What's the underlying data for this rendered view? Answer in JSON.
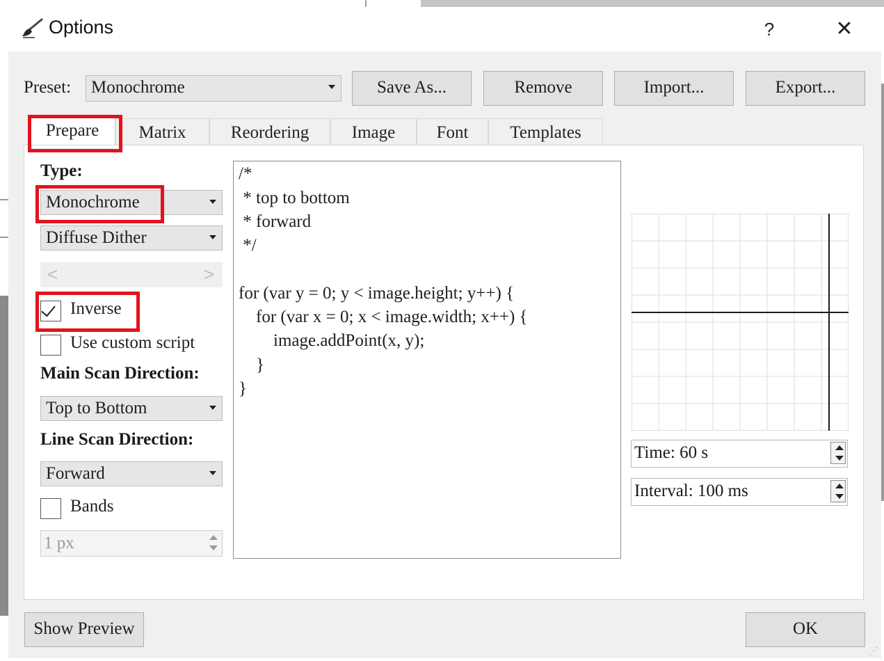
{
  "window": {
    "title": "Options",
    "help_label": "?",
    "close_label": "✕",
    "icon": "paintbrush-icon"
  },
  "preset": {
    "label": "Preset:",
    "value": "Monochrome",
    "buttons": [
      "Save As...",
      "Remove",
      "Import...",
      "Export..."
    ]
  },
  "tabs": [
    "Prepare",
    "Matrix",
    "Reordering",
    "Image",
    "Font",
    "Templates"
  ],
  "active_tab": "Prepare",
  "prepare": {
    "type_label": "Type:",
    "type_value": "Monochrome",
    "dither_value": "Diffuse Dither",
    "slider_left": "<",
    "slider_right": ">",
    "inverse_label": "Inverse",
    "inverse_checked": true,
    "custom_script_label": "Use custom script",
    "custom_script_checked": false,
    "main_scan_label": "Main Scan Direction:",
    "main_scan_value": "Top to Bottom",
    "line_scan_label": "Line Scan Direction:",
    "line_scan_value": "Forward",
    "bands_label": "Bands",
    "bands_checked": false,
    "bands_value": "1 px"
  },
  "script": {
    "lines": [
      "/*",
      " * top to bottom",
      " * forward",
      " */",
      "",
      "for (var y = 0; y < image.height; y++) {",
      "    for (var x = 0; x < image.width; x++) {",
      "        image.addPoint(x, y);",
      "    }",
      "}"
    ]
  },
  "preview": {
    "time_value": "Time: 60 s",
    "interval_value": "Interval: 100 ms"
  },
  "footer": {
    "show_preview_label": "Show Preview",
    "ok_label": "OK"
  },
  "colors": {
    "highlight": "#e0141d",
    "dialog_bg": "#f0f0f0"
  }
}
